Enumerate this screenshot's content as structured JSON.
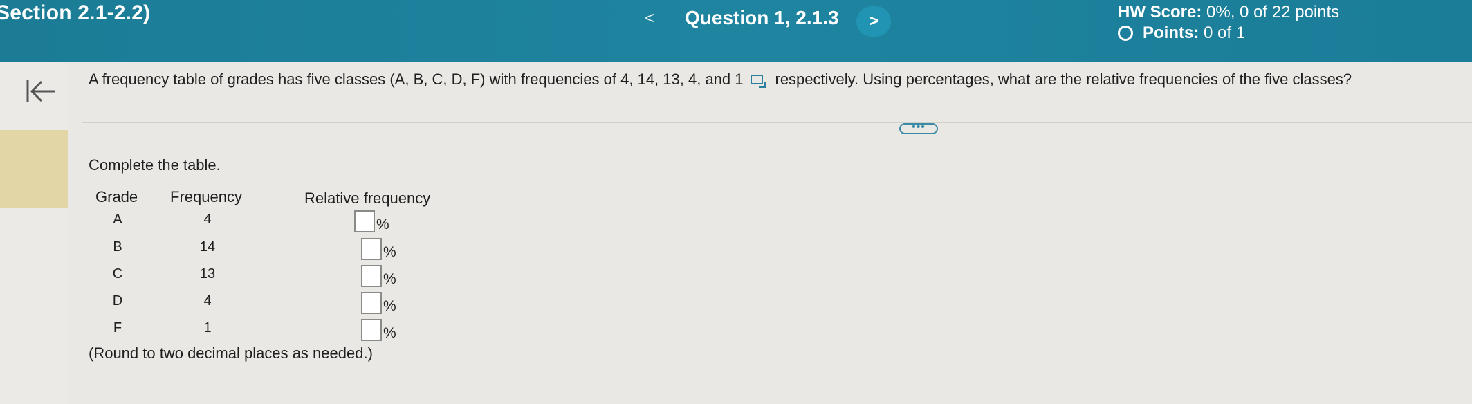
{
  "header": {
    "section_title": "Section 2.1-2.2)",
    "prev_icon": "<",
    "question_title": "Question 1, 2.1.3",
    "next_icon": ">",
    "hw_score_label": "HW Score:",
    "hw_score_value": "0%, 0 of 22 points",
    "points_label": "Points:",
    "points_value": "0 of 1"
  },
  "sidebar": {
    "back_icon": "back-to-start-icon"
  },
  "question": {
    "text_before": "A frequency table of grades has five classes (A, B, C, D, F) with frequencies of 4, 14, 13, 4, and 1",
    "text_after": "respectively. Using percentages, what are the relative frequencies of the five classes?",
    "more_label": "•••"
  },
  "table": {
    "instruction": "Complete the table.",
    "headers": {
      "grade": "Grade",
      "frequency": "Frequency",
      "relative_frequency": "Relative frequency"
    },
    "rows": [
      {
        "grade": "A",
        "frequency": "4",
        "value": "",
        "unit": "%"
      },
      {
        "grade": "B",
        "frequency": "14",
        "value": "",
        "unit": "%"
      },
      {
        "grade": "C",
        "frequency": "13",
        "value": "",
        "unit": "%"
      },
      {
        "grade": "D",
        "frequency": "4",
        "value": "",
        "unit": "%"
      },
      {
        "grade": "F",
        "frequency": "1",
        "value": "",
        "unit": "%"
      }
    ],
    "note": "(Round to two decimal places as needed.)"
  },
  "colors": {
    "header_bg": "#1e84a0",
    "next_button_bg": "#2294b3",
    "sidebar_highlight": "#e2d6a6",
    "page_bg": "#e9e8e4"
  }
}
